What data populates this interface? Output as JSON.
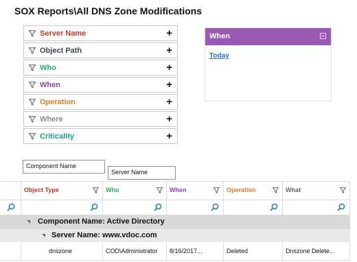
{
  "title": "SOX Reports\\All DNS Zone Modifications",
  "filters": [
    {
      "label": "Server Name",
      "color": "#c0392b"
    },
    {
      "label": "Object Path",
      "color": "#3b4650"
    },
    {
      "label": "Who",
      "color": "#27ae60"
    },
    {
      "label": "When",
      "color": "#8e44ad"
    },
    {
      "label": "Operation",
      "color": "#e67e22"
    },
    {
      "label": "Where",
      "color": "#8a8a8a"
    },
    {
      "label": "Criticality",
      "color": "#16a085"
    }
  ],
  "when_panel": {
    "title": "When",
    "link": "Today",
    "color": "#9b59b6"
  },
  "group_chips": [
    "Component Name",
    "Server Name"
  ],
  "grid": {
    "columns": [
      {
        "label": "Object Type",
        "color": "#c0392b"
      },
      {
        "label": "Who",
        "color": "#27ae60"
      },
      {
        "label": "When",
        "color": "#8e44ad"
      },
      {
        "label": "Operation",
        "color": "#e67e22"
      },
      {
        "label": "What",
        "color": "#666666"
      }
    ],
    "group1": "Component Name: Active Directory",
    "group2": "Server Name: www.vdoc.com",
    "rows": [
      [
        "dnszone",
        "COD\\Administrator",
        "8/16/2017...",
        "Deleted",
        "Dnszone Delete..."
      ]
    ]
  },
  "icons": {
    "filter": "funnel-icon",
    "add": "plus-icon",
    "search": "magnifier-icon",
    "collapse": "collapse-icon"
  }
}
